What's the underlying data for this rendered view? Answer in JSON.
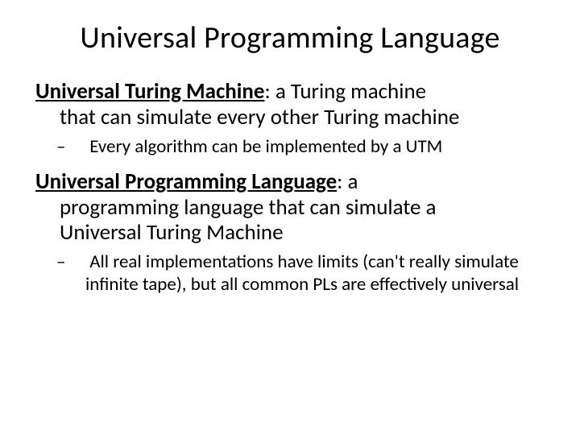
{
  "title": "Universal Programming Language",
  "para1": {
    "term": "Universal Turing Machine",
    "rest_line1": ": a Turing machine",
    "cont": "that can simulate every other Turing machine"
  },
  "sub1": {
    "dash": "–",
    "text": " Every algorithm can be implemented by a UTM"
  },
  "para2": {
    "term": "Universal Programming Language",
    "rest_line1": ": a",
    "cont1": "programming language that can simulate a",
    "cont2": "Universal Turing Machine"
  },
  "sub2": {
    "dash": "–",
    "text": " All real implementations have limits (can't really simulate infinite tape), but all common PLs are effectively universal"
  }
}
